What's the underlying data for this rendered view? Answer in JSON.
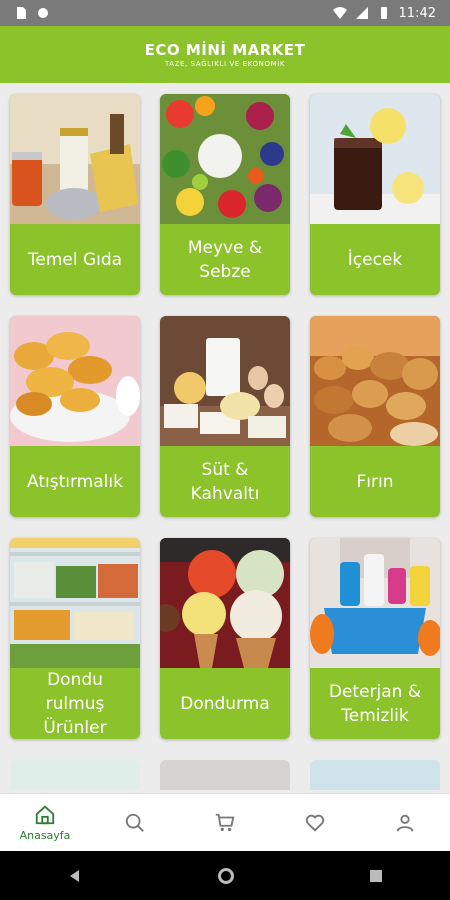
{
  "status_bar": {
    "time": "11:42"
  },
  "app_bar": {
    "title": "ECO MİNİ MARKET",
    "tagline": "TAZE, SAĞLIKLI VE EKONOMİK"
  },
  "categories": [
    {
      "label": "Temel Gıda"
    },
    {
      "label": "Meyve &\nSebze"
    },
    {
      "label": "İçecek"
    },
    {
      "label": "Atıştırmalık"
    },
    {
      "label": "Süt &\nKahvaltı"
    },
    {
      "label": "Fırın"
    },
    {
      "label": "Dondu\nrulmuş\nÜrünler"
    },
    {
      "label": "Dondurma"
    },
    {
      "label": "Deterjan &\nTemizlik"
    }
  ],
  "bottom_nav": {
    "home_label": "Anasayfa",
    "items": [
      "home-icon",
      "search-icon",
      "cart-icon",
      "heart-icon",
      "user-icon"
    ]
  },
  "colors": {
    "accent": "#8cc22a",
    "active_nav": "#2e7d32"
  }
}
